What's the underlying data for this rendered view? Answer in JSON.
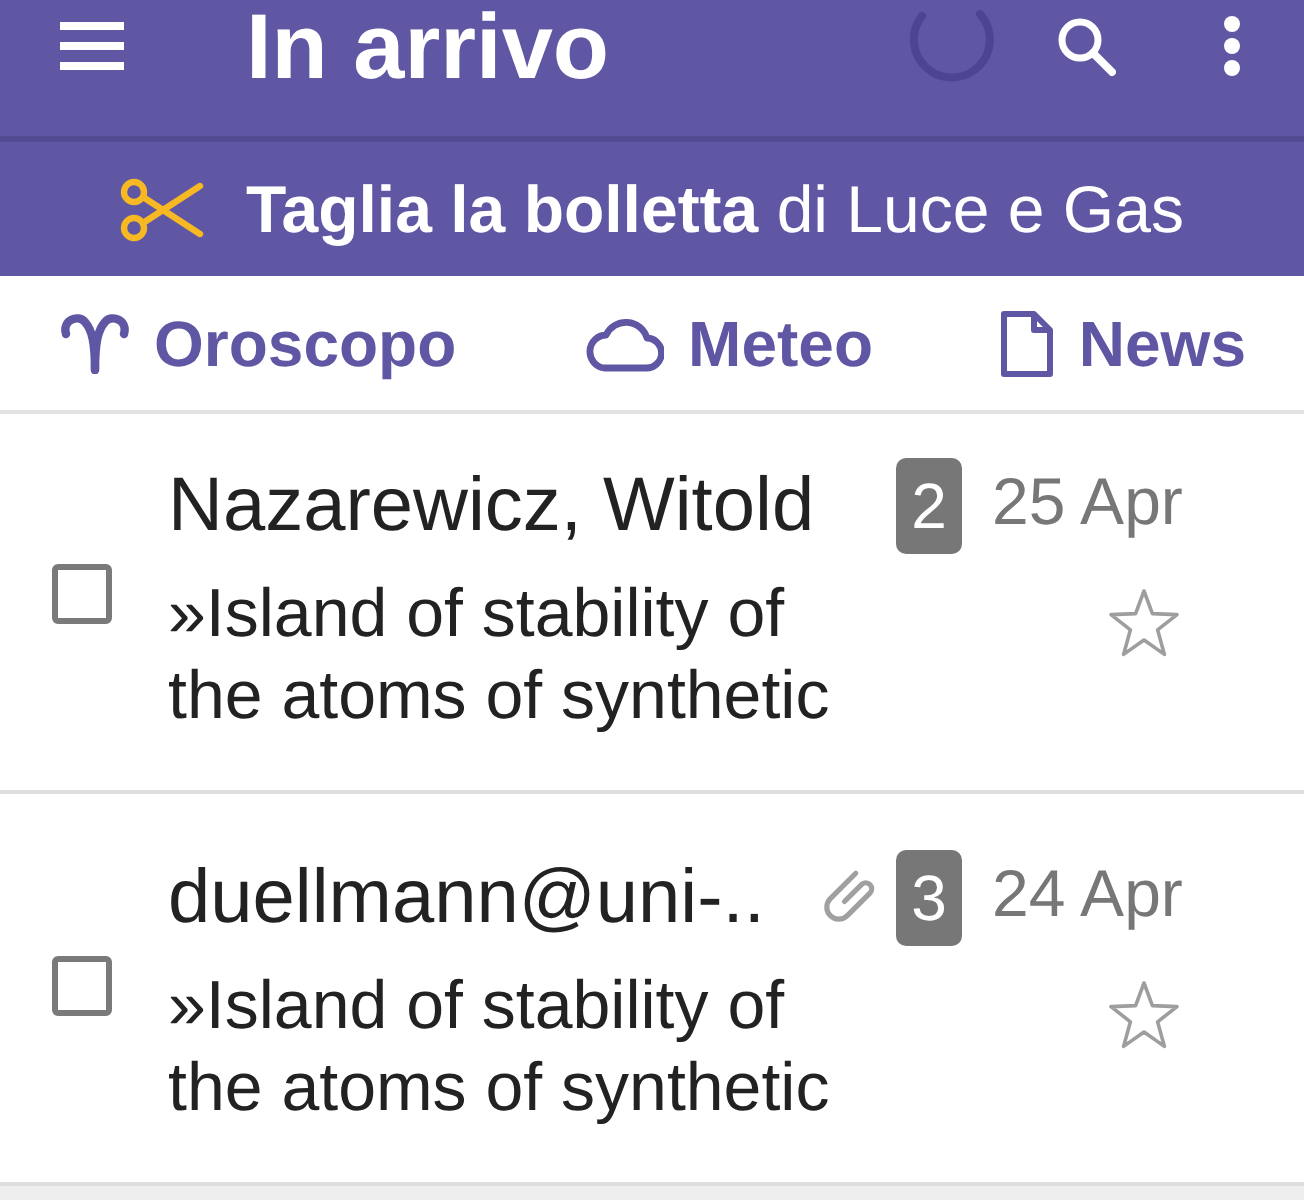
{
  "app_bar": {
    "title": "In arrivo",
    "refreshing": true
  },
  "promo_banner": {
    "text": "**Taglia la bolletta** di Luce e Gas"
  },
  "shortcuts": [
    {
      "kind": "horoscope",
      "label": "Oroscopo"
    },
    {
      "kind": "weather",
      "label": "Meteo"
    },
    {
      "kind": "news",
      "label": "News"
    }
  ],
  "messages": [
    {
      "checked": false,
      "sender": "Nazarewicz, Witold",
      "attachment": false,
      "count": "2",
      "date": "25 Apr",
      "subject": "»Island of stability of the atoms of synthetic",
      "starred": false
    },
    {
      "checked": false,
      "sender": "duellmann@uni-..",
      "attachment": true,
      "count": "3",
      "date": "24 Apr",
      "subject": "»Island of stability of the atoms of synthetic",
      "starred": false
    }
  ]
}
